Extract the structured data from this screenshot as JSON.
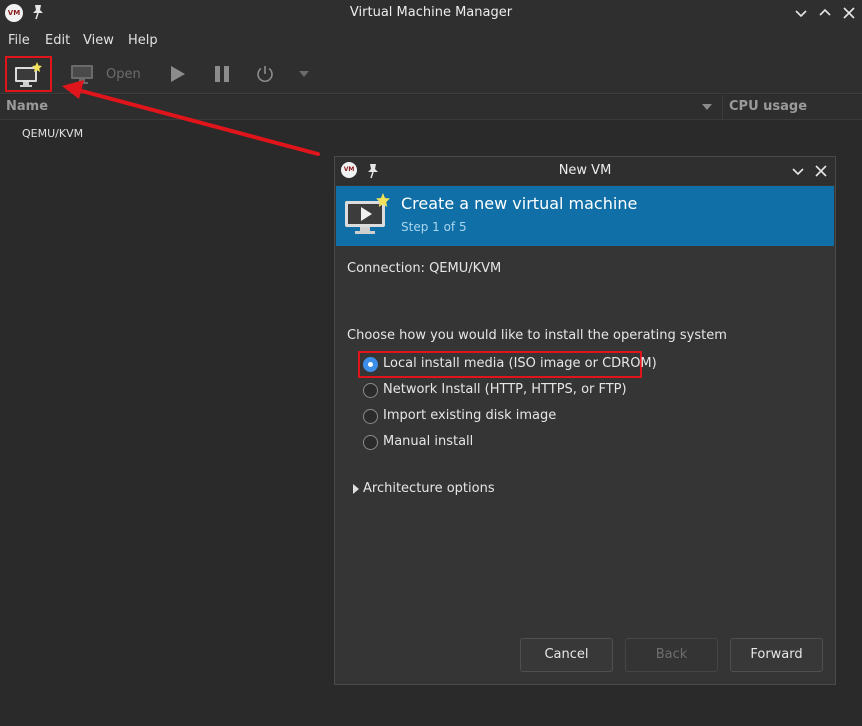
{
  "window": {
    "title": "Virtual Machine Manager",
    "logo_text": "VM"
  },
  "menubar": {
    "items": [
      "File",
      "Edit",
      "View",
      "Help"
    ]
  },
  "toolbar": {
    "open_label": "Open"
  },
  "vm_list": {
    "columns": {
      "name": "Name",
      "cpu": "CPU usage"
    },
    "connections": [
      "QEMU/KVM"
    ]
  },
  "dialog": {
    "title": "New VM",
    "logo_text": "VM",
    "banner": {
      "title": "Create a new virtual machine",
      "step": "Step 1 of 5"
    },
    "connection_label": "Connection:  QEMU/KVM",
    "choose_label": "Choose how you would like to install the operating system",
    "options": [
      {
        "label": "Local install media (ISO image or CDROM)",
        "checked": true
      },
      {
        "label": "Network Install (HTTP, HTTPS, or FTP)",
        "checked": false
      },
      {
        "label": "Import existing disk image",
        "checked": false
      },
      {
        "label": "Manual install",
        "checked": false
      }
    ],
    "architecture_label": "Architecture options",
    "buttons": {
      "cancel": "Cancel",
      "back": "Back",
      "forward": "Forward"
    }
  },
  "colors": {
    "banner": "#0f6fa6",
    "highlight": "#e0151b",
    "radio_checked": "#3d8ee8"
  }
}
